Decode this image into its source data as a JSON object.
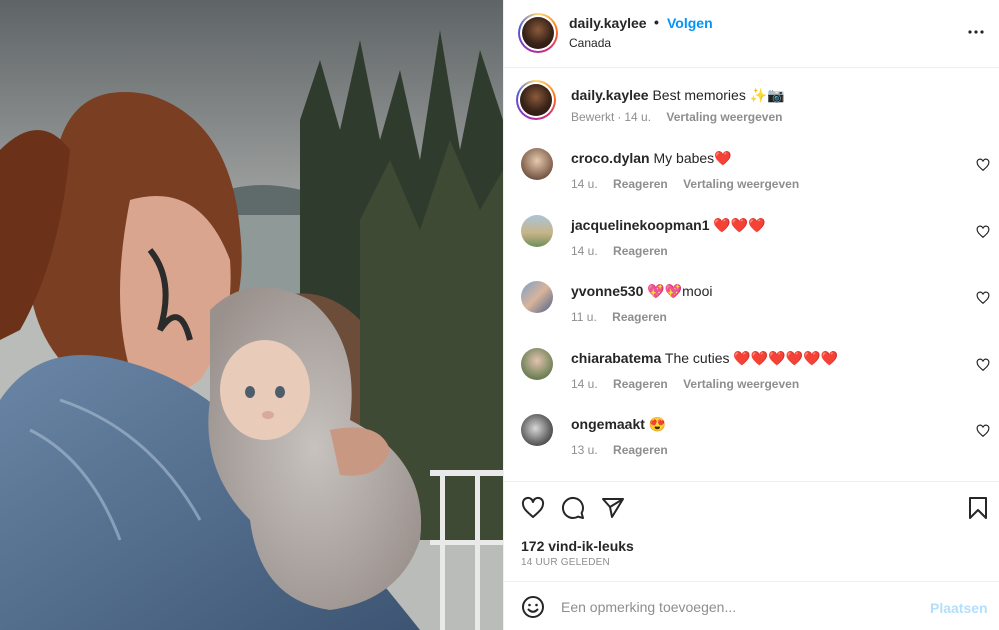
{
  "post": {
    "username": "daily.kaylee",
    "separator": "•",
    "follow_label": "Volgen",
    "location": "Canada"
  },
  "caption": {
    "username": "daily.kaylee",
    "text": "Best memories ✨📷",
    "edited": "Bewerkt",
    "dot": "·",
    "age": "14 u.",
    "translate": "Vertaling weergeven"
  },
  "comments": [
    {
      "username": "croco.dylan",
      "text": "My babes❤️",
      "age": "14 u.",
      "reply": "Reageren",
      "translate": "Vertaling weergeven"
    },
    {
      "username": "jacquelinekoopman1",
      "text": "❤️❤️❤️",
      "age": "14 u.",
      "reply": "Reageren",
      "translate": ""
    },
    {
      "username": "yvonne530",
      "text": "💖💖mooi",
      "age": "11 u.",
      "reply": "Reageren",
      "translate": ""
    },
    {
      "username": "chiarabatema",
      "text": "The cuties ❤️❤️❤️❤️❤️❤️",
      "age": "14 u.",
      "reply": "Reageren",
      "translate": "Vertaling weergeven"
    },
    {
      "username": "ongemaakt",
      "text": "😍",
      "age": "13 u.",
      "reply": "Reageren",
      "translate": ""
    }
  ],
  "stats": {
    "likes": "172 vind-ik-leuks",
    "time": "14 UUR GELEDEN"
  },
  "add_comment": {
    "placeholder": "Een opmerking toevoegen...",
    "post_label": "Plaatsen"
  },
  "icons": {
    "more": "more-icon",
    "like": "heart-icon",
    "comment": "comment-icon",
    "share": "share-icon",
    "save": "bookmark-icon",
    "emoji": "emoji-icon"
  },
  "colors": {
    "accent": "#0095f6",
    "post_disabled": "#b2dffc",
    "muted": "#8e8e8e",
    "text": "#262626"
  }
}
